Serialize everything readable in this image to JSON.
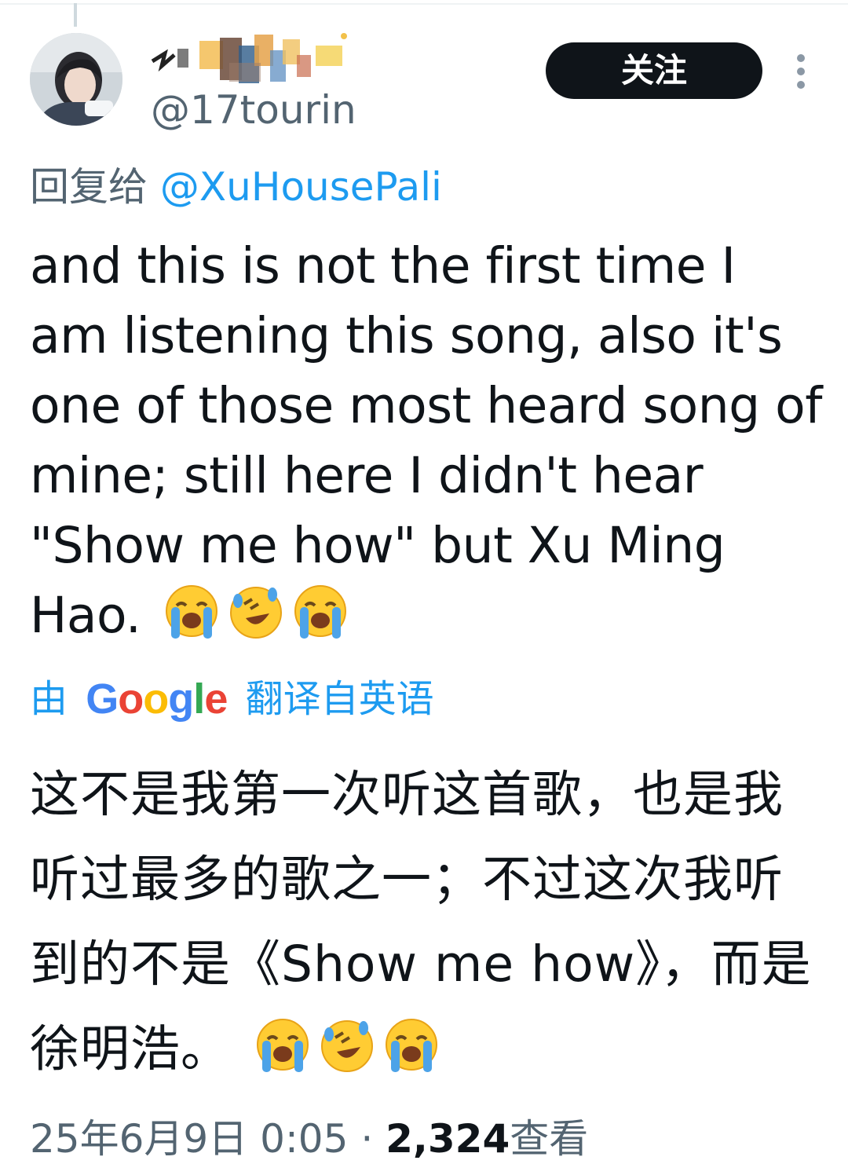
{
  "tweet": {
    "handle": "@17tourin",
    "follow_label": "关注",
    "reply_prefix": "回复给",
    "reply_to": "@XuHousePali",
    "text": "and this is not the first time I am listening this song, also it's one of those most heard song of mine; still here I didn't hear \"Show me how\" but Xu Ming Hao.",
    "emojis": [
      "loudly-crying-face",
      "rolling-on-the-floor-laughing",
      "loudly-crying-face"
    ],
    "translation": {
      "prefix": "由",
      "google_letters": [
        "G",
        "o",
        "o",
        "g",
        "l",
        "e"
      ],
      "suffix": "翻译自英语",
      "text": "这不是我第一次听这首歌，也是我听过最多的歌之一；不过这次我听到的不是《Show me how》，而是徐明浩。"
    },
    "timestamp": "25年6月9日  0:05",
    "separator": " · ",
    "views_count": "2,324",
    "views_label": "查看"
  }
}
